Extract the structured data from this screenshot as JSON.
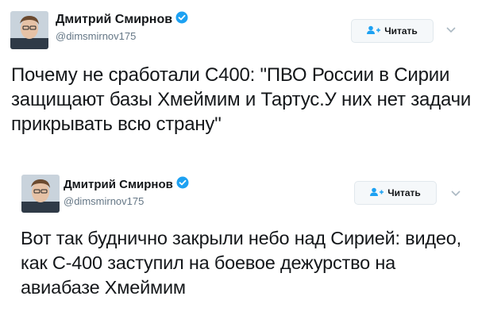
{
  "tweets": [
    {
      "author_name": "Дмитрий Смирнов",
      "handle": "@dimsmirnov175",
      "follow_label": "Читать",
      "text": "Почему не сработали С400: \"ПВО России в Сирии защищают базы Хмеймим и Тартус.У них нет задачи прикрывать всю страну\""
    },
    {
      "author_name": "Дмитрий Смирнов",
      "handle": "@dimsmirnov175",
      "follow_label": "Читать",
      "text": "Вот так буднично закрыли небо над Сирией: видео, как С-400 заступил на боевое дежурство на авиабазе Хмеймим"
    }
  ],
  "icons": {
    "verified": "verified-badge-icon",
    "follow": "follow-user-icon",
    "caret": "chevron-down-icon"
  },
  "colors": {
    "verified_blue": "#1da1f2",
    "handle_gray": "#657786",
    "text": "#14171a",
    "button_bg": "#f5f8fa",
    "button_border": "#e1e8ed"
  }
}
